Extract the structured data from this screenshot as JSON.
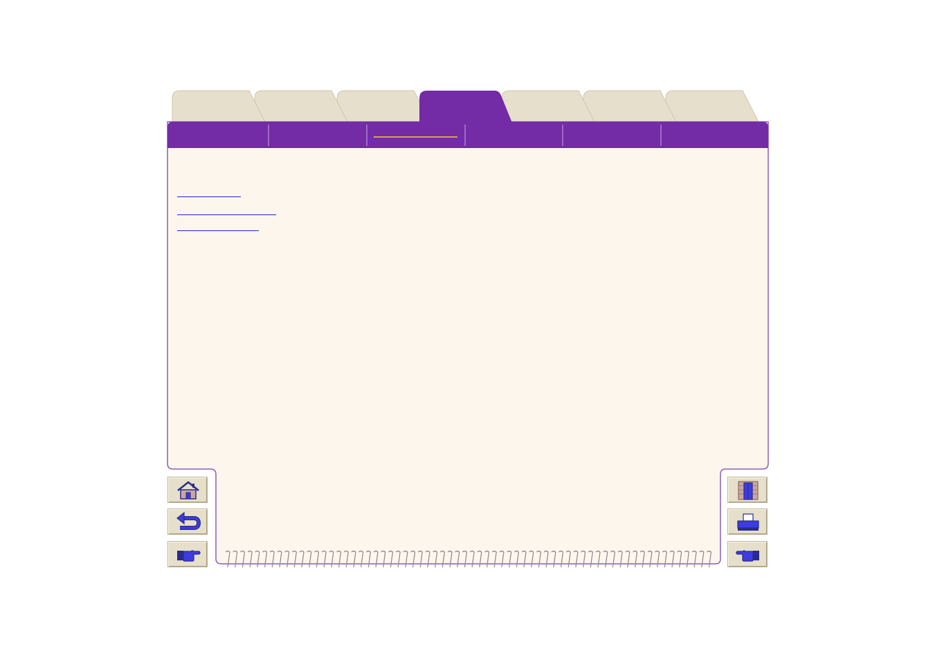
{
  "colors": {
    "accent_purple": "#742ba6",
    "tab_inactive": "#e6dfcc",
    "page_background": "#fdf6ec",
    "button_face": "#e6dfca",
    "link": "#1f1fd0",
    "subtab_underline": "#d8a83a"
  },
  "tabs": [
    {
      "label": "",
      "active": false
    },
    {
      "label": "",
      "active": false
    },
    {
      "label": "",
      "active": false
    },
    {
      "label": "",
      "active": true
    },
    {
      "label": "",
      "active": false
    },
    {
      "label": "",
      "active": false
    },
    {
      "label": "",
      "active": false
    }
  ],
  "subtabs": [
    {
      "label": ""
    },
    {
      "label": ""
    },
    {
      "label": "",
      "selected": true
    },
    {
      "label": ""
    },
    {
      "label": ""
    },
    {
      "label": ""
    }
  ],
  "content": {
    "links": [
      {
        "label": ""
      },
      {
        "label": ""
      },
      {
        "label": ""
      }
    ]
  },
  "nav_buttons": {
    "left": [
      {
        "name": "home-icon"
      },
      {
        "name": "back-arrow-icon"
      },
      {
        "name": "pointing-hand-right-icon"
      }
    ],
    "right": [
      {
        "name": "exit-door-icon"
      },
      {
        "name": "printer-icon"
      },
      {
        "name": "pointing-hand-left-icon"
      }
    ]
  }
}
